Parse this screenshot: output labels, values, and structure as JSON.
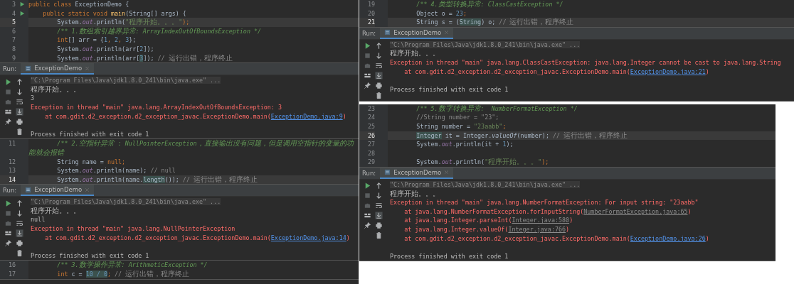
{
  "left": [
    {
      "kind": "editor",
      "lines": [
        {
          "number": "3",
          "run_marker": true,
          "current": false,
          "tokens": [
            {
              "text": "public class ",
              "kind": "keyword"
            },
            {
              "text": "ExceptionDemo {",
              "kind": "plain"
            }
          ]
        },
        {
          "number": "4",
          "run_marker": true,
          "current": false,
          "tokens": [
            {
              "text": "    public static void ",
              "kind": "keyword"
            },
            {
              "text": "main",
              "kind": "method"
            },
            {
              "text": "(String[] args) {",
              "kind": "plain"
            }
          ]
        },
        {
          "number": "5",
          "current": true,
          "tokens": [
            {
              "text": "        System.",
              "kind": "plain"
            },
            {
              "text": "out",
              "kind": "field"
            },
            {
              "text": ".println(",
              "kind": "plain"
            },
            {
              "text": "\"程序开始。。。\"",
              "kind": "string"
            },
            {
              "text": ");",
              "kind": "keyword"
            }
          ]
        },
        {
          "number": "6",
          "current": false,
          "tokens": [
            {
              "text": "        /** 1.数组索引越界异常: ArrayIndexOutOfBoundsException */",
              "kind": "doc"
            }
          ]
        },
        {
          "number": "7",
          "current": false,
          "tokens": [
            {
              "text": "        int",
              "kind": "keyword"
            },
            {
              "text": "[] arr = {",
              "kind": "plain"
            },
            {
              "text": "1",
              "kind": "number"
            },
            {
              "text": ", ",
              "kind": "keyword"
            },
            {
              "text": "2",
              "kind": "number"
            },
            {
              "text": ", ",
              "kind": "keyword"
            },
            {
              "text": "3",
              "kind": "number"
            },
            {
              "text": "};",
              "kind": "plain"
            }
          ]
        },
        {
          "number": "8",
          "current": false,
          "tokens": [
            {
              "text": "        System.",
              "kind": "plain"
            },
            {
              "text": "out",
              "kind": "field"
            },
            {
              "text": ".println(arr[",
              "kind": "plain"
            },
            {
              "text": "2",
              "kind": "number"
            },
            {
              "text": "]);",
              "kind": "plain"
            }
          ]
        },
        {
          "number": "9",
          "current": false,
          "tokens": [
            {
              "text": "        System.",
              "kind": "plain"
            },
            {
              "text": "out",
              "kind": "field"
            },
            {
              "text": ".println(arr[",
              "kind": "plain"
            },
            {
              "text": "3",
              "kind": "number",
              "highlight": true
            },
            {
              "text": "]); ",
              "kind": "plain"
            },
            {
              "text": "// 运行出错，程序终止",
              "kind": "comment"
            }
          ]
        }
      ]
    },
    {
      "kind": "run",
      "run_label": "Run:",
      "tab": {
        "label": "ExceptionDemo",
        "selected": true
      },
      "output": [
        {
          "kind": "command",
          "text": "\"C:\\Program Files\\Java\\jdk1.8.0_241\\bin\\java.exe\" ..."
        },
        {
          "kind": "plain",
          "text": "程序开始。。。"
        },
        {
          "kind": "plain",
          "text": "3"
        },
        {
          "kind": "error",
          "parts": [
            {
              "text": "Exception in thread \"main\" java.lang.ArrayIndexOutOfBoundsException: 3",
              "kind": "text"
            }
          ]
        },
        {
          "kind": "error",
          "parts": [
            {
              "text": "    at com.gdit.d2_exception.d2_exception_javac.ExceptionDemo.main(",
              "kind": "text"
            },
            {
              "text": "ExceptionDemo.java:9",
              "kind": "project_link"
            },
            {
              "text": ")",
              "kind": "text"
            }
          ]
        },
        {
          "kind": "blank"
        },
        {
          "kind": "plain",
          "text": "Process finished with exit code 1"
        }
      ]
    },
    {
      "kind": "editor",
      "lines": [
        {
          "number": "11",
          "current": false,
          "tokens": [
            {
              "text": "        /** 2.空指针异常 : NullPointerException，直接输出没有问题，但是调用空指针的变量的功能就会报错",
              "kind": "doc"
            }
          ]
        },
        {
          "number": "12",
          "current": false,
          "tokens": [
            {
              "text": "        String name = ",
              "kind": "plain"
            },
            {
              "text": "null;",
              "kind": "keyword"
            }
          ]
        },
        {
          "number": "13",
          "current": false,
          "tokens": [
            {
              "text": "        System.",
              "kind": "plain"
            },
            {
              "text": "out",
              "kind": "field"
            },
            {
              "text": ".println(name); ",
              "kind": "plain"
            },
            {
              "text": "// null",
              "kind": "comment"
            }
          ]
        },
        {
          "number": "14",
          "current": true,
          "tokens": [
            {
              "text": "        System.",
              "kind": "plain"
            },
            {
              "text": "out",
              "kind": "field"
            },
            {
              "text": ".println(name.",
              "kind": "plain"
            },
            {
              "text": "length",
              "kind": "plain",
              "highlight": true
            },
            {
              "text": "()); ",
              "kind": "plain"
            },
            {
              "text": "// 运行出错，程序终止",
              "kind": "comment"
            }
          ]
        }
      ]
    },
    {
      "kind": "run",
      "run_label": "Run:",
      "tab": {
        "label": "ExceptionDemo",
        "selected": true
      },
      "output": [
        {
          "kind": "command",
          "text": "\"C:\\Program Files\\Java\\jdk1.8.0_241\\bin\\java.exe\" ..."
        },
        {
          "kind": "plain",
          "text": "程序开始。。。"
        },
        {
          "kind": "plain",
          "text": "null"
        },
        {
          "kind": "error",
          "parts": [
            {
              "text": "Exception in thread \"main\" java.lang.NullPointerException",
              "kind": "text"
            }
          ]
        },
        {
          "kind": "error",
          "parts": [
            {
              "text": "    at com.gdit.d2_exception.d2_exception_javac.ExceptionDemo.main(",
              "kind": "text"
            },
            {
              "text": "ExceptionDemo.java:14",
              "kind": "project_link"
            },
            {
              "text": ")",
              "kind": "text"
            }
          ]
        },
        {
          "kind": "blank"
        },
        {
          "kind": "plain",
          "text": "Process finished with exit code 1"
        }
      ]
    },
    {
      "kind": "editor",
      "lines": [
        {
          "number": "16",
          "current": false,
          "tokens": [
            {
              "text": "        /** 3.数学操作异常: ArithmeticException */",
              "kind": "doc"
            }
          ]
        },
        {
          "number": "17",
          "current": false,
          "tokens": [
            {
              "text": "        int",
              "kind": "keyword"
            },
            {
              "text": " c = ",
              "kind": "plain"
            },
            {
              "text": "10 / 0",
              "kind": "number",
              "highlight": true
            },
            {
              "text": "; ",
              "kind": "keyword"
            },
            {
              "text": "// 运行出错，程序终止",
              "kind": "comment"
            }
          ]
        }
      ]
    }
  ],
  "right": [
    {
      "kind": "editor",
      "lines": [
        {
          "number": "19",
          "current": false,
          "tokens": [
            {
              "text": "        /** 4.类型转换异常: ClassCastException */",
              "kind": "doc"
            }
          ]
        },
        {
          "number": "20",
          "current": false,
          "tokens": [
            {
              "text": "        Object o = ",
              "kind": "plain"
            },
            {
              "text": "23",
              "kind": "number"
            },
            {
              "text": ";",
              "kind": "keyword"
            }
          ]
        },
        {
          "number": "21",
          "current": true,
          "tokens": [
            {
              "text": "        String s = (",
              "kind": "plain"
            },
            {
              "text": "String",
              "kind": "plain",
              "highlight": true
            },
            {
              "text": ") o; ",
              "kind": "plain"
            },
            {
              "text": "// 运行出错，程序终止",
              "kind": "comment"
            }
          ]
        }
      ]
    },
    {
      "kind": "run",
      "run_label": "Run:",
      "tab": {
        "label": "ExceptionDemo",
        "selected": true
      },
      "output": [
        {
          "kind": "command",
          "text": "\"C:\\Program Files\\Java\\jdk1.8.0_241\\bin\\java.exe\" ..."
        },
        {
          "kind": "plain",
          "text": "程序开始。。。"
        },
        {
          "kind": "error",
          "parts": [
            {
              "text": "Exception in thread \"main\" java.lang.ClassCastException: java.lang.Integer cannot be cast to java.lang.String",
              "kind": "text"
            }
          ]
        },
        {
          "kind": "error",
          "parts": [
            {
              "text": "    at com.gdit.d2_exception.d2_exception_javac.ExceptionDemo.main(",
              "kind": "text"
            },
            {
              "text": "ExceptionDemo.java:21",
              "kind": "project_link"
            },
            {
              "text": ")",
              "kind": "text"
            }
          ]
        },
        {
          "kind": "blank"
        },
        {
          "kind": "plain",
          "text": "Process finished with exit code 1"
        }
      ]
    },
    {
      "kind": "editor",
      "lines": [
        {
          "number": "23",
          "current": false,
          "tokens": [
            {
              "text": "        /** 5.数字转换异常:  NumberFormatException */",
              "kind": "doc"
            }
          ]
        },
        {
          "number": "24",
          "current": false,
          "tokens": [
            {
              "text": "        //String number = \"23\";",
              "kind": "comment"
            }
          ]
        },
        {
          "number": "25",
          "current": false,
          "tokens": [
            {
              "text": "        String number = ",
              "kind": "plain"
            },
            {
              "text": "\"23aabb\"",
              "kind": "string"
            },
            {
              "text": ";",
              "kind": "keyword"
            }
          ]
        },
        {
          "number": "26",
          "current": true,
          "tokens": [
            {
              "text": "        Integer",
              "kind": "plain",
              "highlight": true
            },
            {
              "text": " it = Integer.",
              "kind": "plain"
            },
            {
              "text": "valueOf",
              "kind": "static"
            },
            {
              "text": "(number); ",
              "kind": "plain"
            },
            {
              "text": "// 运行出错，程序终止",
              "kind": "comment"
            }
          ]
        },
        {
          "number": "27",
          "current": false,
          "tokens": [
            {
              "text": "        System.",
              "kind": "plain"
            },
            {
              "text": "out",
              "kind": "field"
            },
            {
              "text": ".println(it + ",
              "kind": "plain"
            },
            {
              "text": "1",
              "kind": "number"
            },
            {
              "text": ");",
              "kind": "plain"
            }
          ]
        },
        {
          "number": "28",
          "current": false
        },
        {
          "number": "29",
          "current": false,
          "tokens": [
            {
              "text": "        System.",
              "kind": "plain"
            },
            {
              "text": "out",
              "kind": "field"
            },
            {
              "text": ".println(",
              "kind": "plain"
            },
            {
              "text": "\"程序开始。。。\"",
              "kind": "string"
            },
            {
              "text": ");",
              "kind": "keyword"
            }
          ]
        }
      ]
    },
    {
      "kind": "run",
      "run_label": "Run:",
      "tab": {
        "label": "ExceptionDemo",
        "selected": true
      },
      "output": [
        {
          "kind": "command",
          "text": "\"C:\\Program Files\\Java\\jdk1.8.0_241\\bin\\java.exe\" ..."
        },
        {
          "kind": "plain",
          "text": "程序开始。。。"
        },
        {
          "kind": "error",
          "parts": [
            {
              "text": "Exception in thread \"main\" java.lang.NumberFormatException: For input string: \"23aabb\"",
              "kind": "text"
            }
          ]
        },
        {
          "kind": "error",
          "parts": [
            {
              "text": "    at java.lang.NumberFormatException.forInputString(",
              "kind": "text"
            },
            {
              "text": "NumberFormatException.java:65",
              "kind": "library_link"
            },
            {
              "text": ")",
              "kind": "text"
            }
          ]
        },
        {
          "kind": "error",
          "parts": [
            {
              "text": "    at java.lang.Integer.parseInt(",
              "kind": "text"
            },
            {
              "text": "Integer.java:580",
              "kind": "library_link"
            },
            {
              "text": ")",
              "kind": "text"
            }
          ]
        },
        {
          "kind": "error",
          "parts": [
            {
              "text": "    at java.lang.Integer.valueOf(",
              "kind": "text"
            },
            {
              "text": "Integer.java:766",
              "kind": "library_link"
            },
            {
              "text": ")",
              "kind": "text"
            }
          ]
        },
        {
          "kind": "error",
          "parts": [
            {
              "text": "    at com.gdit.d2_exception.d2_exception_javac.ExceptionDemo.main(",
              "kind": "text"
            },
            {
              "text": "ExceptionDemo.java:26",
              "kind": "project_link"
            },
            {
              "text": ")",
              "kind": "text"
            }
          ]
        },
        {
          "kind": "blank"
        },
        {
          "kind": "plain",
          "text": "Process finished with exit code 1"
        }
      ]
    }
  ]
}
